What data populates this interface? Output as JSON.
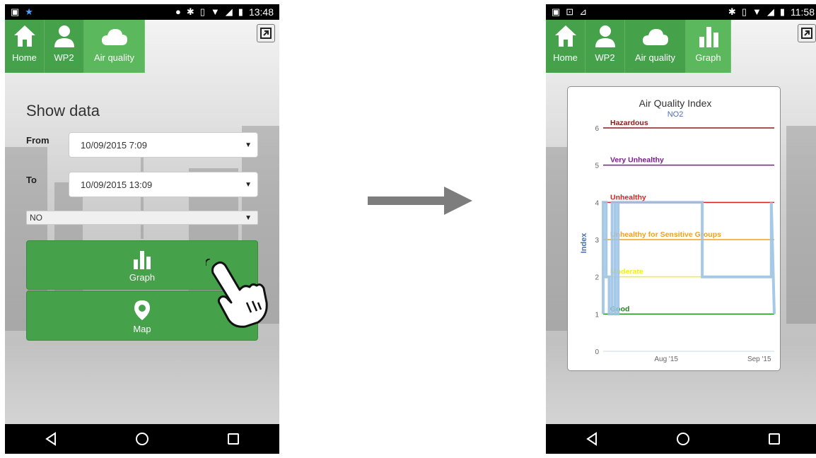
{
  "screen_left": {
    "status": {
      "time": "13:48"
    },
    "tabs": [
      {
        "label": "Home",
        "icon": "home-icon"
      },
      {
        "label": "WP2",
        "icon": "person-icon"
      },
      {
        "label": "Air quality",
        "icon": "cloud-icon"
      }
    ],
    "form": {
      "title": "Show data",
      "from_label": "From",
      "from_value": "10/09/2015 7:09",
      "to_label": "To",
      "to_value": "10/09/2015 13:09",
      "pollutant_value": "NO"
    },
    "buttons": {
      "graph_label": "Graph",
      "map_label": "Map"
    }
  },
  "screen_right": {
    "status": {
      "time": "11:58"
    },
    "tabs": [
      {
        "label": "Home",
        "icon": "home-icon"
      },
      {
        "label": "WP2",
        "icon": "person-icon"
      },
      {
        "label": "Air quality",
        "icon": "cloud-icon"
      },
      {
        "label": "Graph",
        "icon": "bar-chart-icon"
      }
    ]
  },
  "colors": {
    "tab_green": "#45a14a",
    "active_tab_green": "#5cb85c",
    "hazardous": "#8b1a1a",
    "very_unhealthy": "#7a1e8c",
    "unhealthy": "#e01e1e",
    "sensitive": "#f0a020",
    "moderate": "#f0f020",
    "good": "#1a8a1a",
    "series": "#9dc3e6"
  },
  "chart_data": {
    "type": "line",
    "title": "Air Quality Index",
    "subtitle": "NO2",
    "ylabel": "Index",
    "ylim": [
      0,
      6
    ],
    "yticks": [
      0,
      1,
      2,
      3,
      4,
      5,
      6
    ],
    "xticks": [
      "Aug '15",
      "Sep '15"
    ],
    "thresholds": [
      {
        "label": "Hazardous",
        "value": 6,
        "color": "#8b1a1a"
      },
      {
        "label": "Very Unhealthy",
        "value": 5,
        "color": "#7a1e8c"
      },
      {
        "label": "Unhealthy",
        "value": 4,
        "color": "#e01e1e"
      },
      {
        "label": "Unhealthy for Sensitive Groups",
        "value": 3,
        "color": "#f0a020"
      },
      {
        "label": "Moderate",
        "value": 2,
        "color": "#f0f020"
      },
      {
        "label": "Good",
        "value": 1,
        "color": "#1a8a1a"
      }
    ],
    "series": [
      {
        "x": [
          "2015-07-11",
          "2015-07-11",
          "2015-07-12",
          "2015-07-12",
          "2015-07-13",
          "2015-07-13",
          "2015-07-14",
          "2015-07-14",
          "2015-07-15",
          "2015-07-15",
          "2015-07-16",
          "2015-07-16",
          "2015-08-13",
          "2015-08-13",
          "2015-09-05",
          "2015-09-05",
          "2015-09-06"
        ],
        "y": [
          1,
          4,
          4,
          2,
          2,
          1,
          1,
          4,
          4,
          1,
          1,
          4,
          4,
          2,
          2,
          4,
          1
        ]
      }
    ]
  }
}
